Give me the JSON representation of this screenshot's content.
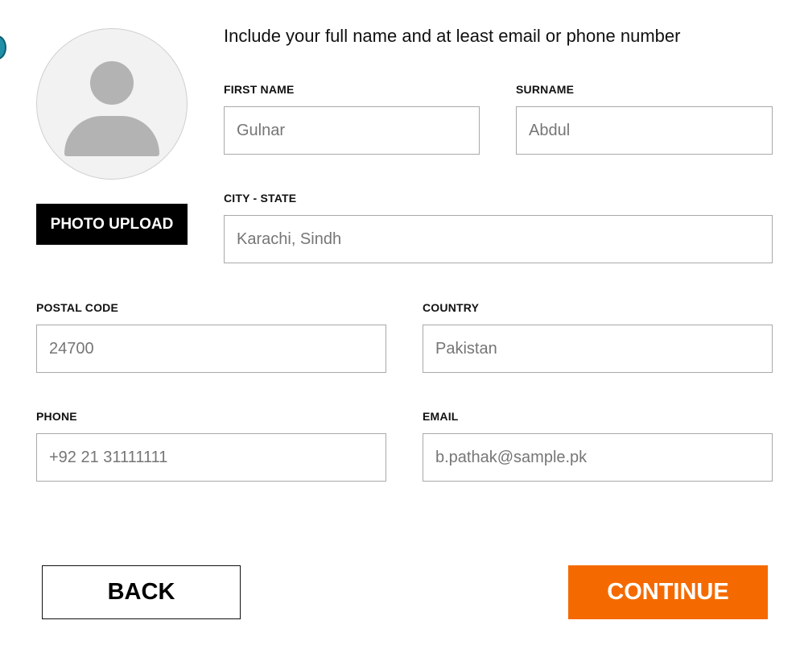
{
  "headline": "Include your full name and at least email or phone number",
  "photo_upload_label": "PHOTO UPLOAD",
  "fields": {
    "first_name": {
      "label": "FIRST NAME",
      "placeholder": "Gulnar"
    },
    "surname": {
      "label": "SURNAME",
      "placeholder": "Abdul"
    },
    "city_state": {
      "label": "CITY - STATE",
      "placeholder": "Karachi, Sindh"
    },
    "postal_code": {
      "label": "POSTAL CODE",
      "placeholder": "24700"
    },
    "country": {
      "label": "COUNTRY",
      "placeholder": "Pakistan"
    },
    "phone": {
      "label": "PHONE",
      "placeholder": "+92 21 31111111"
    },
    "email": {
      "label": "EMAIL",
      "placeholder": "b.pathak@sample.pk"
    }
  },
  "buttons": {
    "back": "BACK",
    "continue": "CONTINUE"
  },
  "icons": {
    "avatar": "user-avatar-placeholder-icon"
  },
  "colors": {
    "accent": "#f56a00",
    "photo_button": "#000000",
    "field_border": "#a9a9a9",
    "placeholder_text": "#767676"
  }
}
